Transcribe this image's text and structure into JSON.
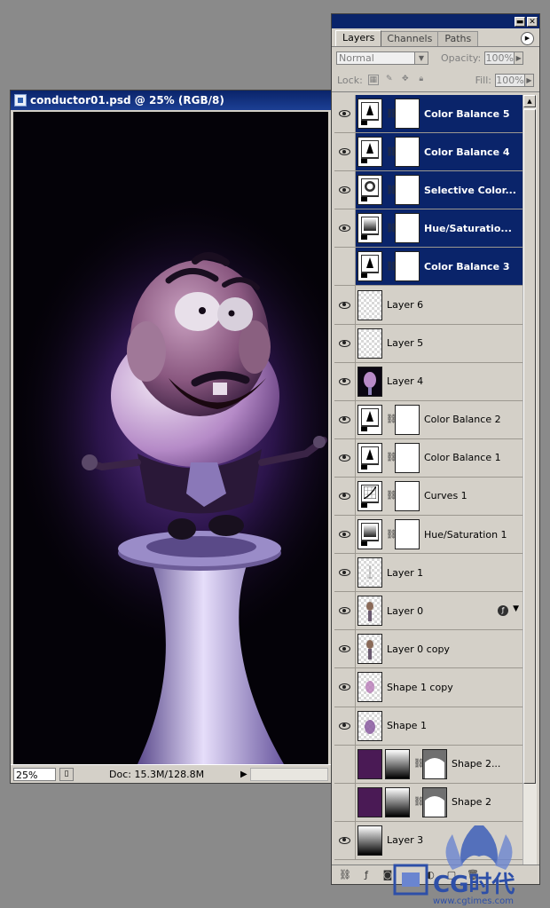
{
  "document": {
    "title": "conductor01.psd @ 25% (RGB/8)",
    "zoom": "25%",
    "doc_info": "Doc: 15.3M/128.8M"
  },
  "palette": {
    "tabs": [
      {
        "label": "Layers"
      },
      {
        "label": "Channels"
      },
      {
        "label": "Paths"
      }
    ],
    "blend_mode": "Normal",
    "opacity_label": "Opacity:",
    "opacity_value": "100%",
    "lock_label": "Lock:",
    "fill_label": "Fill:",
    "fill_value": "100%"
  },
  "layers": [
    {
      "name": "Color Balance 5",
      "selected": true,
      "visible": true,
      "kind": "adjustment",
      "icon": "balance-icon"
    },
    {
      "name": "Color Balance 4",
      "selected": true,
      "visible": true,
      "kind": "adjustment",
      "icon": "balance-icon"
    },
    {
      "name": "Selective Color...",
      "selected": true,
      "visible": true,
      "kind": "adjustment",
      "icon": "selective-color-icon"
    },
    {
      "name": "Hue/Saturatio...",
      "selected": true,
      "visible": true,
      "kind": "adjustment",
      "icon": "hue-saturation-icon"
    },
    {
      "name": "Color Balance 3",
      "selected": true,
      "visible": false,
      "kind": "adjustment",
      "icon": "balance-icon"
    },
    {
      "name": "Layer 6",
      "selected": false,
      "visible": true,
      "kind": "empty"
    },
    {
      "name": "Layer 5",
      "selected": false,
      "visible": true,
      "kind": "empty"
    },
    {
      "name": "Layer 4",
      "selected": false,
      "visible": true,
      "kind": "character"
    },
    {
      "name": "Color Balance 2",
      "selected": false,
      "visible": true,
      "kind": "adjustment",
      "icon": "balance-icon"
    },
    {
      "name": "Color Balance 1",
      "selected": false,
      "visible": true,
      "kind": "adjustment",
      "icon": "balance-icon"
    },
    {
      "name": "Curves 1",
      "selected": false,
      "visible": true,
      "kind": "adjustment",
      "icon": "curves-icon"
    },
    {
      "name": "Hue/Saturation 1",
      "selected": false,
      "visible": true,
      "kind": "adjustment",
      "icon": "hue-saturation-icon"
    },
    {
      "name": "Layer 1",
      "selected": false,
      "visible": true,
      "kind": "sketch"
    },
    {
      "name": "Layer 0",
      "selected": false,
      "visible": true,
      "kind": "figure",
      "effects": true
    },
    {
      "name": "Layer 0 copy",
      "selected": false,
      "visible": true,
      "kind": "figure"
    },
    {
      "name": "Shape 1 copy",
      "selected": false,
      "visible": true,
      "kind": "blob-pink"
    },
    {
      "name": "Shape 1",
      "selected": false,
      "visible": true,
      "kind": "blob-purple"
    },
    {
      "name": "Shape 2...",
      "selected": false,
      "visible": false,
      "kind": "shape"
    },
    {
      "name": "Shape 2",
      "selected": false,
      "visible": false,
      "kind": "shape"
    },
    {
      "name": "Layer 3",
      "selected": false,
      "visible": true,
      "kind": "gradient"
    }
  ],
  "colors": {
    "title_bar": "#0a246a",
    "selection": "#0a246a",
    "panel_bg": "#d4d0c8",
    "shape_fill": "#4a1a55"
  },
  "watermark": {
    "brand": "CG时代",
    "url": "www.cgtimes.com"
  }
}
